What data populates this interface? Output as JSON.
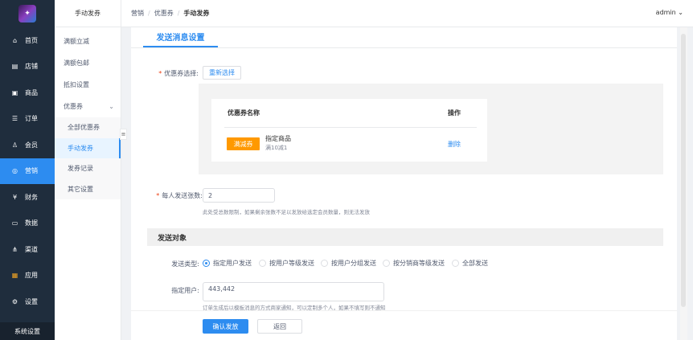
{
  "sidebar": {
    "items": [
      {
        "label": "首页",
        "icon": "home-icon"
      },
      {
        "label": "店铺",
        "icon": "store-icon"
      },
      {
        "label": "商品",
        "icon": "goods-icon"
      },
      {
        "label": "订单",
        "icon": "order-icon"
      },
      {
        "label": "会员",
        "icon": "member-icon"
      },
      {
        "label": "营销",
        "icon": "marketing-icon"
      },
      {
        "label": "财务",
        "icon": "finance-icon"
      },
      {
        "label": "数据",
        "icon": "data-icon"
      },
      {
        "label": "渠道",
        "icon": "channel-icon"
      },
      {
        "label": "应用",
        "icon": "apps-icon"
      },
      {
        "label": "设置",
        "icon": "settings-icon"
      }
    ],
    "active_index": 5,
    "bottom_label": "系统设置",
    "active_color": "#2d8cf0"
  },
  "subnav": {
    "title": "手动发券",
    "items": [
      "满额立减",
      "满额包邮",
      "抵扣设置",
      "优惠券"
    ],
    "children": [
      "全部优惠券",
      "手动发券",
      "发券记录",
      "其它设置"
    ],
    "active_child": 1
  },
  "header": {
    "breadcrumb": [
      "营销",
      "优惠券",
      "手动发券"
    ],
    "user": "admin"
  },
  "tab": {
    "label": "发送消息设置"
  },
  "coupon_select": {
    "label": "优惠券选择:",
    "button": "重新选择",
    "table": {
      "headers": [
        "优惠券名称",
        "操作"
      ],
      "rows": [
        {
          "tag": "满减券",
          "name": "指定商品",
          "desc": "满10减1",
          "action": "删除"
        }
      ]
    }
  },
  "per_person": {
    "label": "每人发送张数:",
    "value": "2",
    "hint": "此处受总数限制，如果剩余张数不足以发放给选定会员数量，则无法发放"
  },
  "target": {
    "section_title": "发送对象",
    "type_label": "发送类型:",
    "options": [
      "指定用户发送",
      "按用户等级发送",
      "按用户分组发送",
      "按分销商等级发送",
      "全部发送"
    ],
    "selected": 0,
    "users_label": "指定用户:",
    "users_value": "443,442",
    "users_hint": "订单生成后以模板消息的方式商家通知，可以定制多个人，如果不填写则不通知"
  },
  "footer": {
    "confirm": "确认发放",
    "back": "返回"
  }
}
